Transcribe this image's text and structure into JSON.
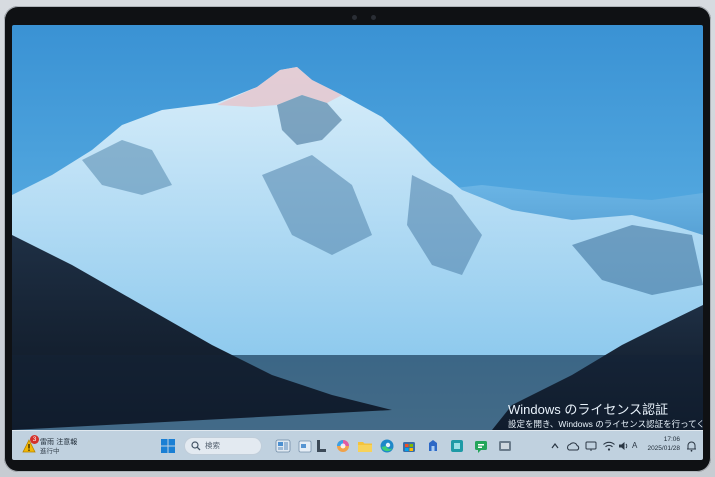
{
  "desktop": {
    "wallpaper": "mountain-landscape",
    "sky_color": "#4a9ed8",
    "snow_color": "#bfe2f5"
  },
  "activation": {
    "title": "Windows のライセンス認証",
    "subtitle": "設定を開き、Windows のライセンス認証を行ってくださ"
  },
  "taskbar": {
    "weather": {
      "badge": "3",
      "title": "雷雨 注意報",
      "subtitle": "進行中",
      "icon": "weather-alert-icon"
    },
    "start_icon": "windows-start-icon",
    "search": {
      "placeholder": "検索",
      "icon": "search-icon"
    },
    "apps": [
      {
        "name": "widgets",
        "icon": "widgets-icon"
      },
      {
        "name": "task-view",
        "icon": "task-view-icon"
      },
      {
        "name": "copilot",
        "icon": "copilot-icon"
      },
      {
        "name": "file-explorer",
        "icon": "folder-icon"
      },
      {
        "name": "edge",
        "icon": "edge-icon"
      },
      {
        "name": "store",
        "icon": "store-icon"
      },
      {
        "name": "app-blue",
        "icon": "app-icon"
      },
      {
        "name": "app-teal",
        "icon": "app-icon"
      },
      {
        "name": "app-green",
        "icon": "app-icon"
      },
      {
        "name": "app-gray",
        "icon": "app-icon"
      }
    ],
    "tray": {
      "chevron": "chevron-up-icon",
      "items": [
        "cloud-icon",
        "network-icon",
        "wifi-icon",
        "volume-icon",
        "ime-indicator",
        "battery-icon"
      ],
      "ime_label": "A"
    },
    "clock": {
      "time": "17:06",
      "date": "2025/01/28"
    },
    "notification_icon": "bell-icon"
  }
}
